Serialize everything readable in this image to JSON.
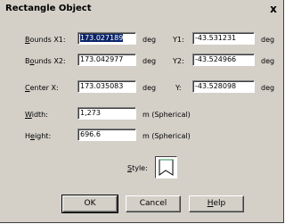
{
  "window": {
    "title": "Rectangle Object",
    "close_glyph": "x"
  },
  "fields": {
    "bounds_x1": {
      "label_pre": "",
      "label_u": "B",
      "label_post": "ounds X1:",
      "value": "173.027189",
      "unit": "deg"
    },
    "y1": {
      "label": "Y1:",
      "value": "-43.531231",
      "unit": "deg"
    },
    "bounds_x2": {
      "label_pre": "B",
      "label_u": "o",
      "label_post": "unds X2:",
      "value": "173.042977",
      "unit": "deg"
    },
    "y2": {
      "label": "Y2:",
      "value": "-43.524966",
      "unit": "deg"
    },
    "center_x": {
      "label_pre": "",
      "label_u": "C",
      "label_post": "enter X:",
      "value": "173.035083",
      "unit": "deg"
    },
    "center_y": {
      "label": "Y:",
      "value": "-43.528098",
      "unit": "deg"
    },
    "width": {
      "label_pre": "",
      "label_u": "W",
      "label_post": "idth:",
      "value": "1,273",
      "unit": "m (Spherical)"
    },
    "height": {
      "label_pre": "H",
      "label_u": "e",
      "label_post": "ight:",
      "value": "696.6",
      "unit": "m (Spherical)"
    }
  },
  "style": {
    "label_pre": "",
    "label_u": "S",
    "label_post": "tyle:",
    "swatch_fill": "#ffffff",
    "swatch_stroke": "#000000",
    "swatch_accent": "#2e8b57"
  },
  "buttons": {
    "ok": "OK",
    "cancel": "Cancel",
    "help_pre": "",
    "help_u": "H",
    "help_post": "elp"
  }
}
